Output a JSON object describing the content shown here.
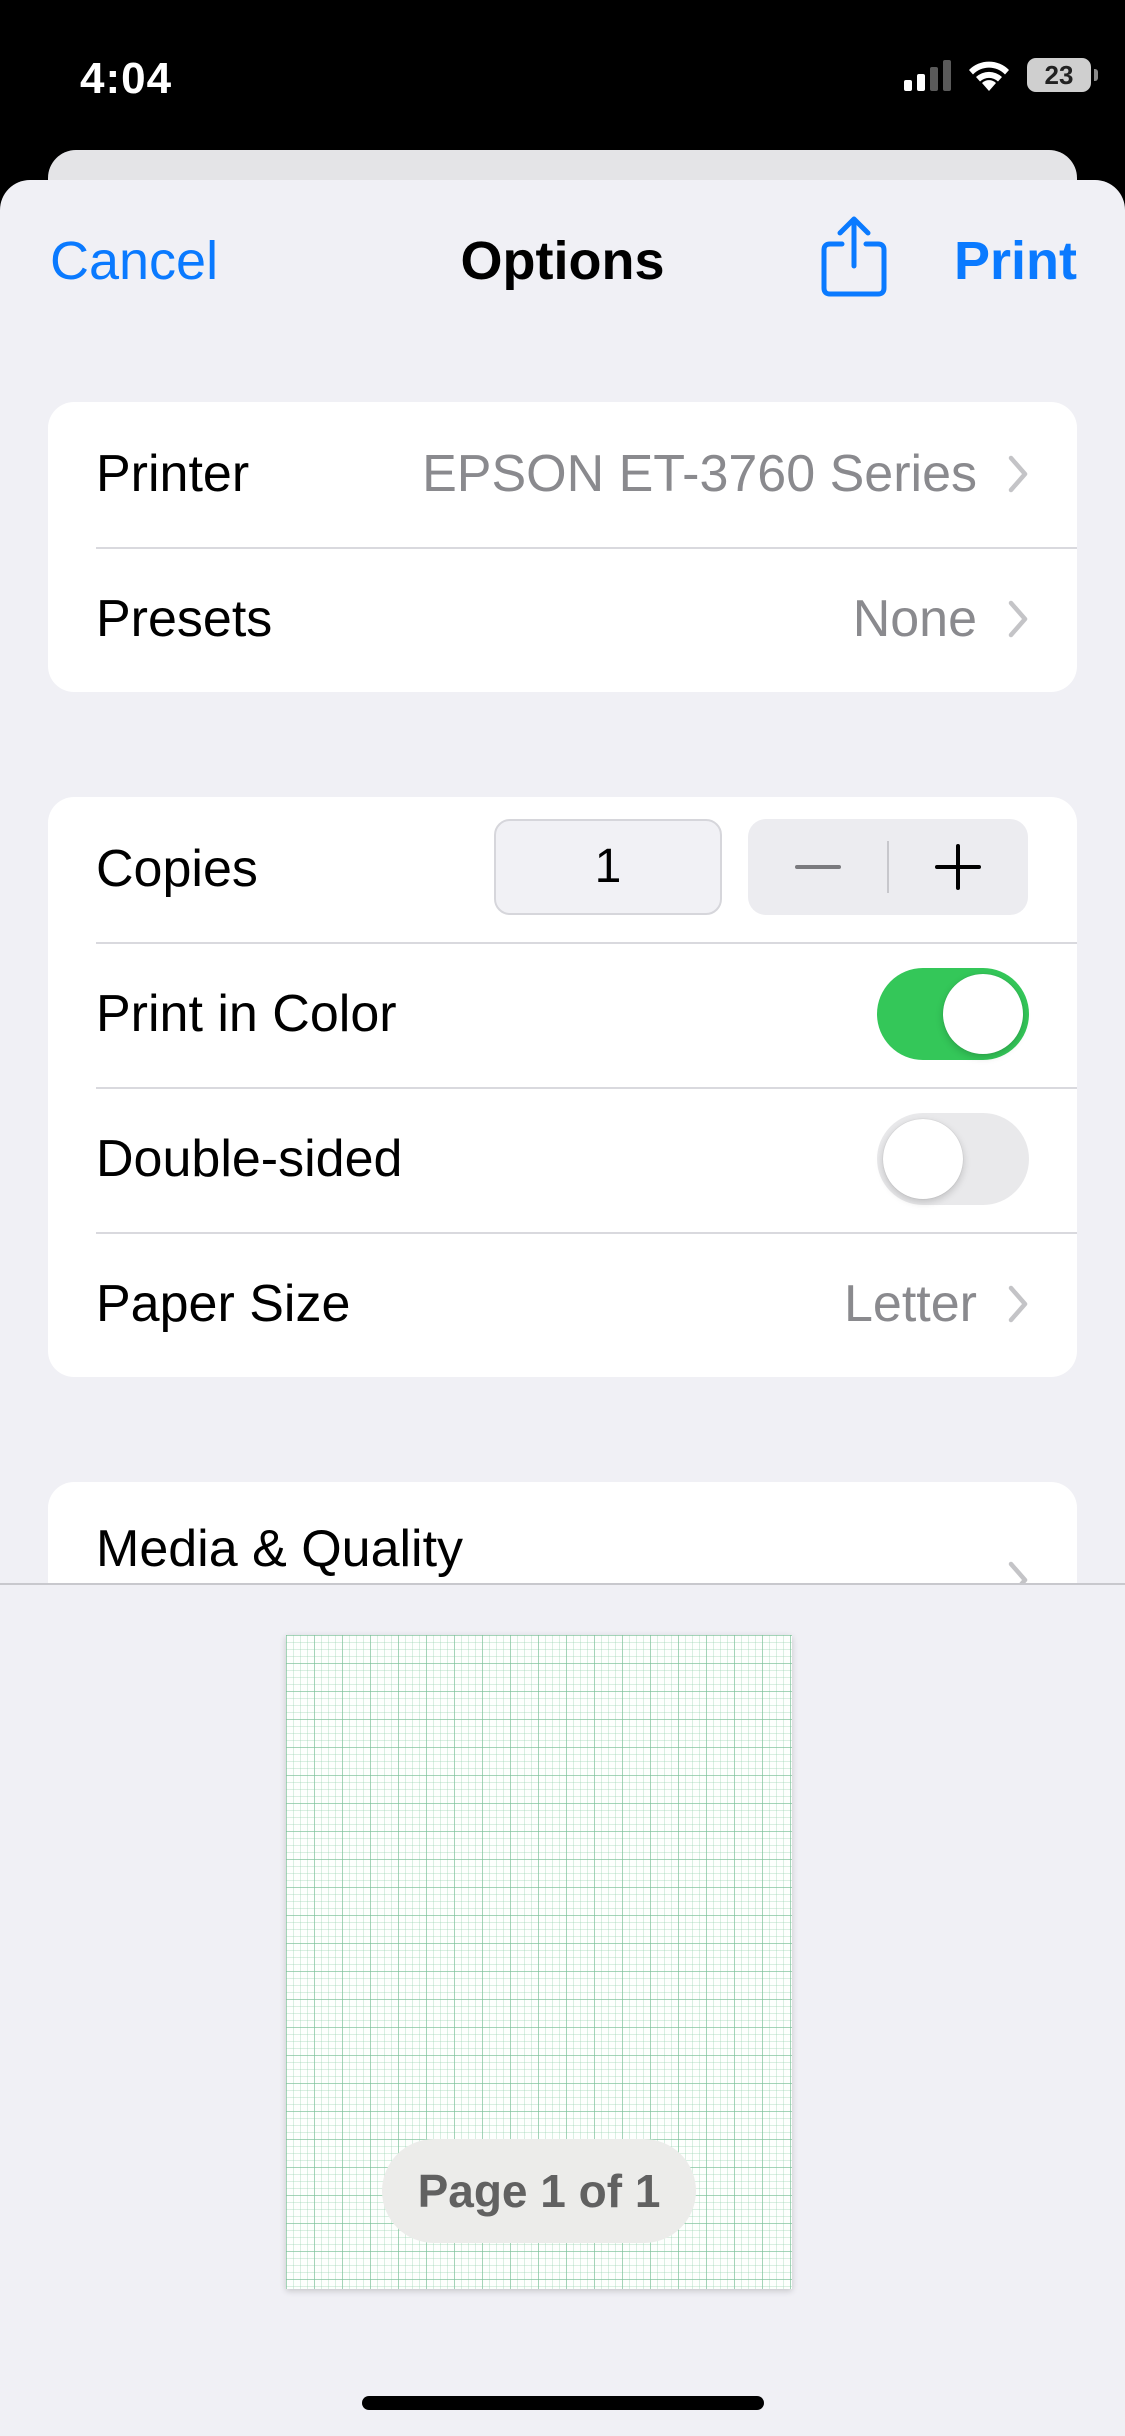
{
  "status_bar": {
    "time": "4:04",
    "battery_level": "23",
    "icons": [
      "signal-bars-icon",
      "wifi-icon",
      "battery-icon"
    ]
  },
  "nav": {
    "cancel_label": "Cancel",
    "title": "Options",
    "print_label": "Print",
    "share_icon": "share-icon"
  },
  "printer_group": {
    "printer_label": "Printer",
    "printer_value": "EPSON ET-3760 Series",
    "presets_label": "Presets",
    "presets_value": "None"
  },
  "settings_group": {
    "copies_label": "Copies",
    "copies_value": "1",
    "print_in_color_label": "Print in Color",
    "print_in_color_on": true,
    "double_sided_label": "Double-sided",
    "double_sided_on": false,
    "paper_size_label": "Paper Size",
    "paper_size_value": "Letter"
  },
  "media_group": {
    "media_quality_label": "Media & Quality"
  },
  "preview": {
    "page_indicator": "Page 1 of 1"
  },
  "colors": {
    "accent": "#0a7aff",
    "toggle_on": "#34c759",
    "background": "#f0f0f5"
  }
}
